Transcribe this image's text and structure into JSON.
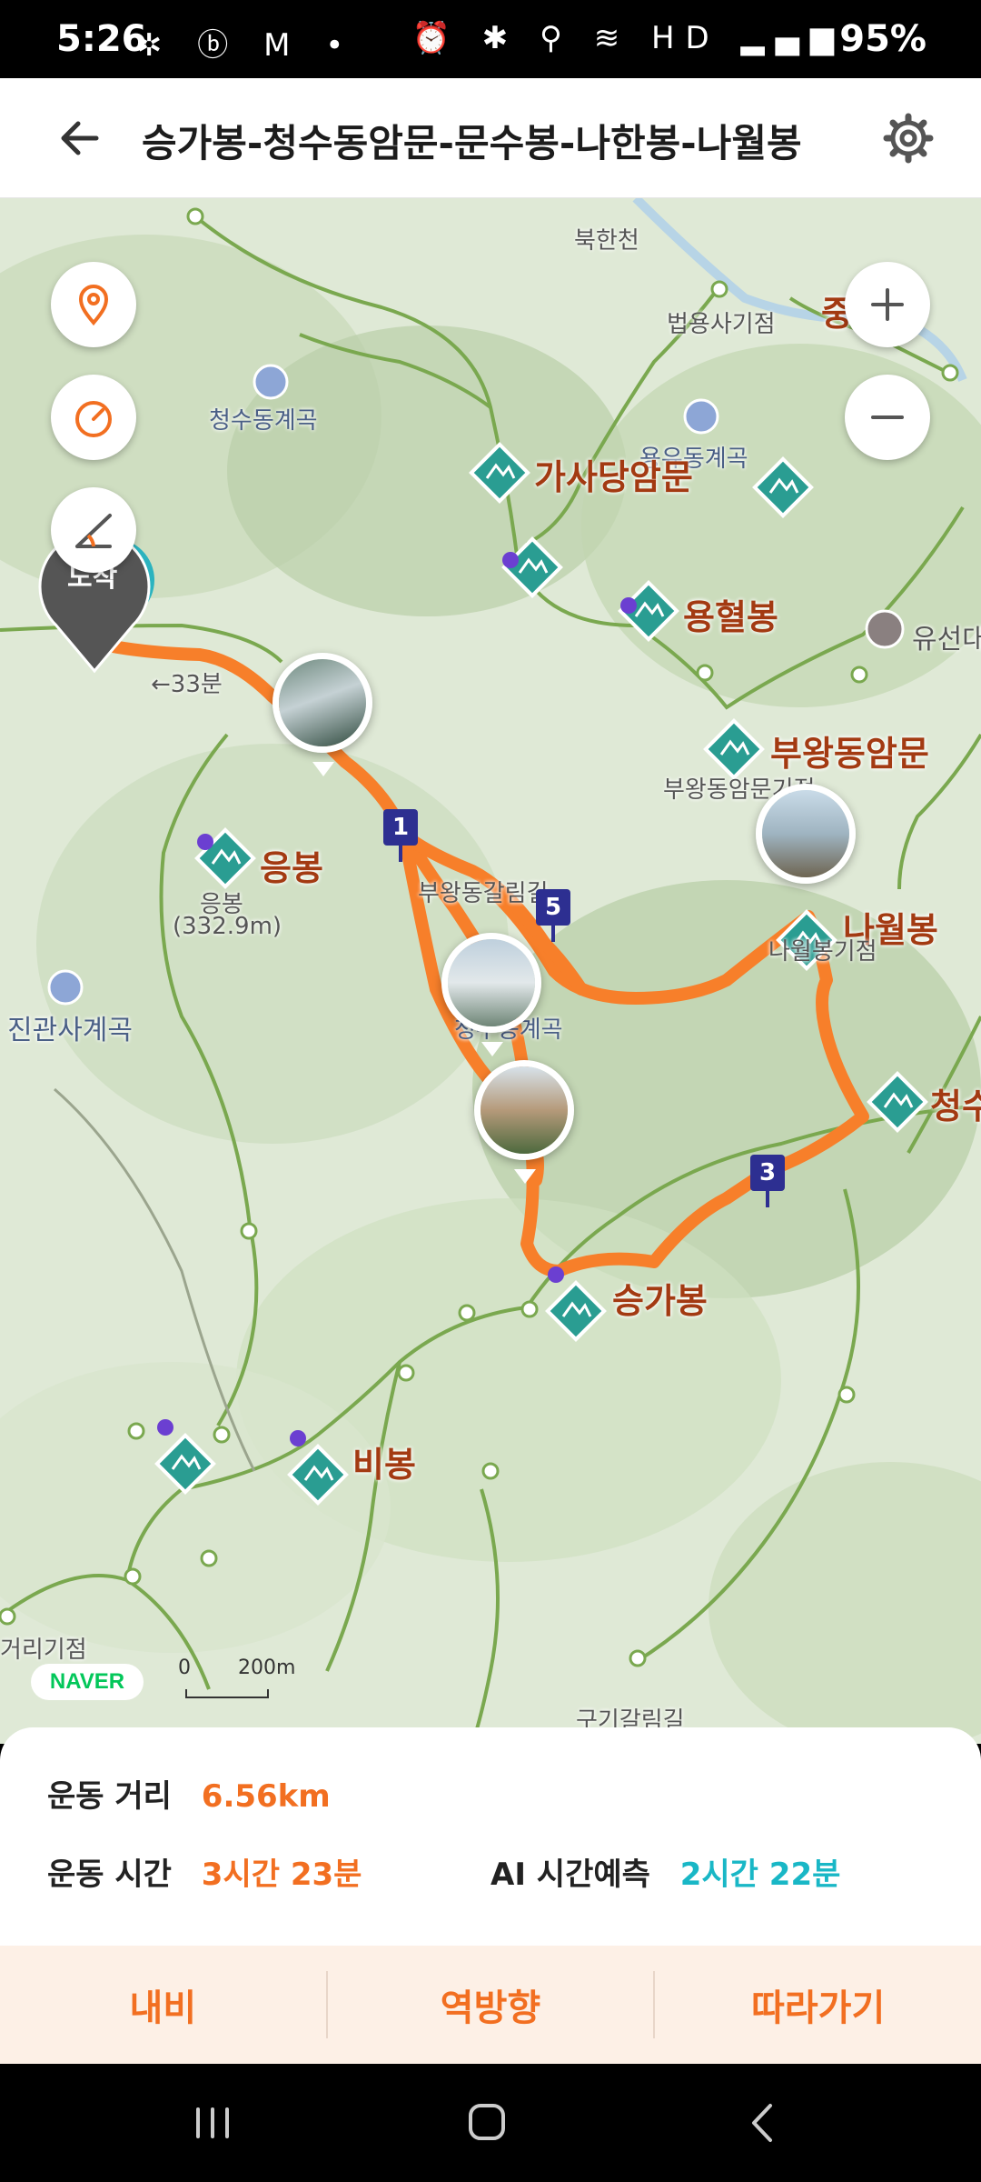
{
  "status": {
    "time": "5:26",
    "left_icons": "✲ ⓑ M •",
    "right_icons": "⏰ ✱ ⚲ ≋ HD ▂▄▆",
    "battery": "95%"
  },
  "header": {
    "title": "승가봉-청수동암문-문수봉-나한봉-나월봉",
    "back_icon": "back-arrow-icon",
    "settings_icon": "gear-icon"
  },
  "map": {
    "labels": {
      "bukhancheon": "북한천",
      "beopyongsa": "법용사기점",
      "jung": "중",
      "cheongsudong_valley": "청수동계곡",
      "yongyu_valley": "용유동계곡",
      "gasadang": "가사당암문",
      "yonghyeolbong": "용혈봉",
      "yuseondae": "유선대",
      "buwangdong": "부왕동암문",
      "buwangdong_point": "부왕동암문기점",
      "minutes33": "←33분",
      "eungbong": "응봉",
      "eungbong_sub": "응봉",
      "eungbong_elev": "(332.9m)",
      "buwang_junction": "부왕동갈림길",
      "nawolbong": "나월봉",
      "nawol_point": "나월봉기점",
      "jingwansa": "진관사계곡",
      "cheongsudong_valley2": "청수동계곡",
      "cheongsu": "청수",
      "seunggabong": "승가봉",
      "bibong": "비봉",
      "georigijeom": "거리기점",
      "gugigal": "구기갈림길",
      "start": "도착"
    },
    "waypoints": [
      "1",
      "5",
      "3"
    ],
    "scale_zero": "0",
    "scale_label": "200m",
    "naver": "NAVER",
    "route_color": "#f77f2a"
  },
  "stats": {
    "distance_label": "운동 거리",
    "distance_value": "6.56km",
    "time_label": "운동 시간",
    "time_value": "3시간 23분",
    "ai_label": "AI 시간예측",
    "ai_value": "2시간 22분"
  },
  "actions": {
    "navi": "내비",
    "reverse": "역방향",
    "follow": "따라가기"
  }
}
